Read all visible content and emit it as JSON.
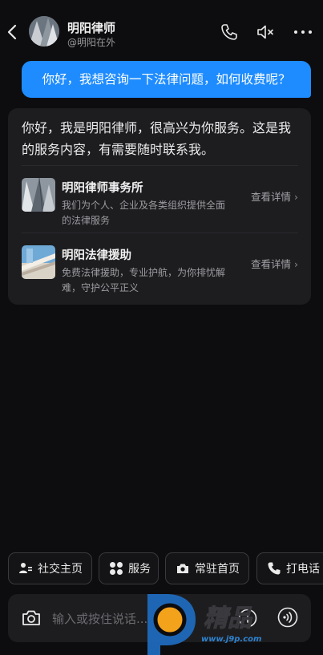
{
  "header": {
    "name": "明阳律师",
    "handle": "@明阳在外",
    "icons": [
      "back-icon",
      "phone-icon",
      "mute-icon",
      "more-icon"
    ]
  },
  "messages": {
    "user": "你好，我想咨询一下法律问题，如何收费呢？",
    "reply": "你好，我是明阳律师，很高兴为你服务。这是我的服务内容，有需要随时联系我。"
  },
  "services": [
    {
      "title": "明阳律师事务所",
      "desc": "我们为个人、企业及各类组织提供全面的法律服务",
      "link": "查看详情"
    },
    {
      "title": "明阳法律援助",
      "desc": "免费法律援助，专业护航，为你排忧解难，守护公平正义",
      "link": "查看详情"
    }
  ],
  "quick_actions": [
    {
      "label": "社交主页",
      "icon": "profile-card-icon"
    },
    {
      "label": "服务",
      "icon": "grid-icon"
    },
    {
      "label": "常驻首页",
      "icon": "camera-pin-icon"
    },
    {
      "label": "打电话",
      "icon": "phone-icon"
    }
  ],
  "input": {
    "placeholder": "输入或按住说话..."
  },
  "watermark": {
    "text": "www.j9p.com"
  },
  "colors": {
    "background": "#0d0d0f",
    "accent": "#1e8cff",
    "card": "#1d1d20"
  }
}
